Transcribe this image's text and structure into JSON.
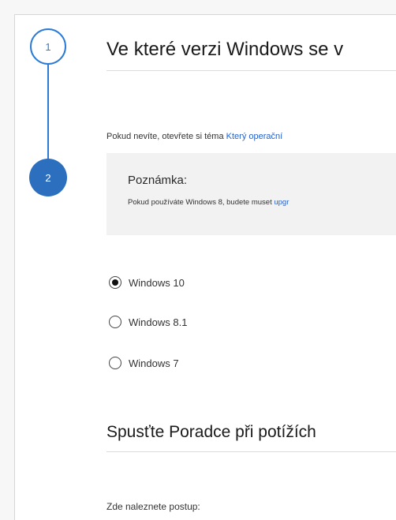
{
  "stepper": {
    "steps": [
      {
        "number": "1",
        "state": "completed"
      },
      {
        "number": "2",
        "state": "active"
      }
    ]
  },
  "question": {
    "heading": "Ve které verzi Windows se v",
    "intro_text": "Pokud nevíte, otevřete si téma ",
    "intro_link": "Který operační"
  },
  "note": {
    "title": "Poznámka:",
    "body_text": "Pokud používáte Windows 8, budete muset ",
    "body_link": "upgr"
  },
  "options": [
    {
      "label": "Windows 10",
      "selected": true
    },
    {
      "label": "Windows 8.1",
      "selected": false
    },
    {
      "label": "Windows 7",
      "selected": false
    }
  ],
  "section2": {
    "heading": "Spusťte Poradce při potížích",
    "steps_label": "Zde naleznete postup:"
  },
  "colors": {
    "accent": "#2b7bd6",
    "active_step": "#2b6fbe",
    "link": "#2563c9"
  }
}
